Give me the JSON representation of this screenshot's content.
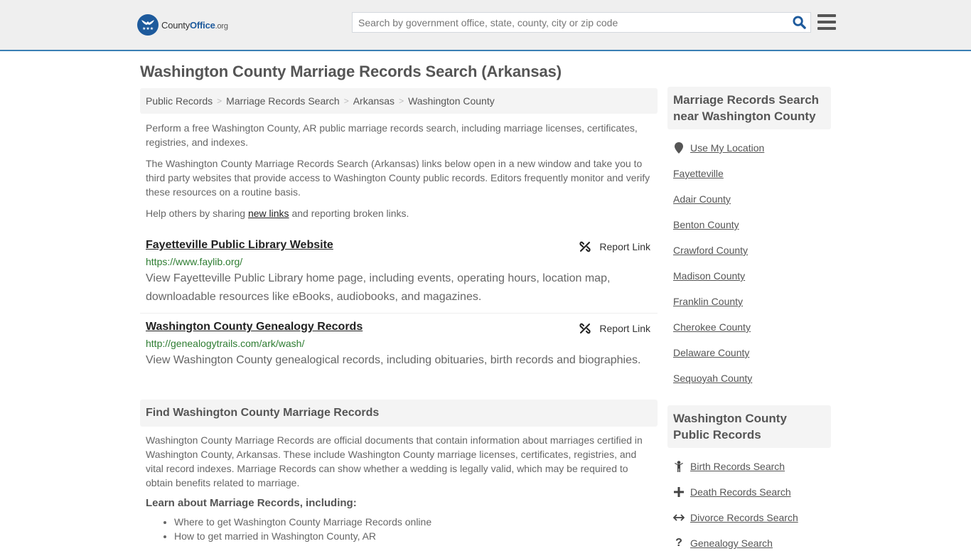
{
  "header": {
    "logo": {
      "name": "County",
      "name_bold": "Office",
      "tld": ".org"
    },
    "search": {
      "placeholder": "Search by government office, state, county, city or zip code",
      "value": ""
    },
    "colors": {
      "brand": "#1d5a9c",
      "accent_border": "#3a7fb4"
    }
  },
  "page": {
    "title": "Washington County Marriage Records Search (Arkansas)",
    "breadcrumb": [
      {
        "label": "Public Records"
      },
      {
        "label": "Marriage Records Search"
      },
      {
        "label": "Arkansas"
      },
      {
        "label": "Washington County"
      }
    ],
    "intro": {
      "p1": "Perform a free Washington County, AR public marriage records search, including marriage licenses, certificates, registries, and indexes.",
      "p2": "The Washington County Marriage Records Search (Arkansas) links below open in a new window and take you to third party websites that provide access to Washington County public records. Editors frequently monitor and verify these resources on a routine basis.",
      "p3_before": "Help others by sharing ",
      "p3_link": "new links",
      "p3_after": " and reporting broken links."
    },
    "links": [
      {
        "title": "Fayetteville Public Library Website",
        "url": "https://www.faylib.org/",
        "description": "View Fayetteville Public Library home page, including events, operating hours, location map, downloadable resources like eBooks, audiobooks, and magazines.",
        "report_label": "Report Link"
      },
      {
        "title": "Washington County Genealogy Records",
        "url": "http://genealogytrails.com/ark/wash/",
        "description": "View Washington County genealogical records, including obituaries, birth records and biographies.",
        "report_label": "Report Link"
      }
    ],
    "find_section": {
      "heading": "Find Washington County Marriage Records",
      "body": "Washington County Marriage Records are official documents that contain information about marriages certified in Washington County, Arkansas. These include Washington County marriage licenses, certificates, registries, and vital record indexes. Marriage Records can show whether a wedding is legally valid, which may be required to obtain benefits related to marriage.",
      "learn_heading": "Learn about Marriage Records, including:",
      "learn_items": [
        "Where to get Washington County Marriage Records online",
        "How to get married in Washington County, AR"
      ]
    }
  },
  "sidebar": {
    "nearby": {
      "heading": "Marriage Records Search near Washington County",
      "use_location": {
        "label": "Use My Location",
        "icon": "map-marker-icon"
      },
      "items": [
        "Fayetteville",
        "Adair County",
        "Benton County",
        "Crawford County",
        "Madison County",
        "Franklin County",
        "Cherokee County",
        "Delaware County",
        "Sequoyah County"
      ]
    },
    "public_records": {
      "heading": "Washington County Public Records",
      "items": [
        {
          "label": "Birth Records Search",
          "icon": "child-icon"
        },
        {
          "label": "Death Records Search",
          "icon": "plus-icon"
        },
        {
          "label": "Divorce Records Search",
          "icon": "arrows-horizontal-icon"
        },
        {
          "label": "Genealogy Search",
          "icon": "question-icon"
        }
      ]
    }
  }
}
